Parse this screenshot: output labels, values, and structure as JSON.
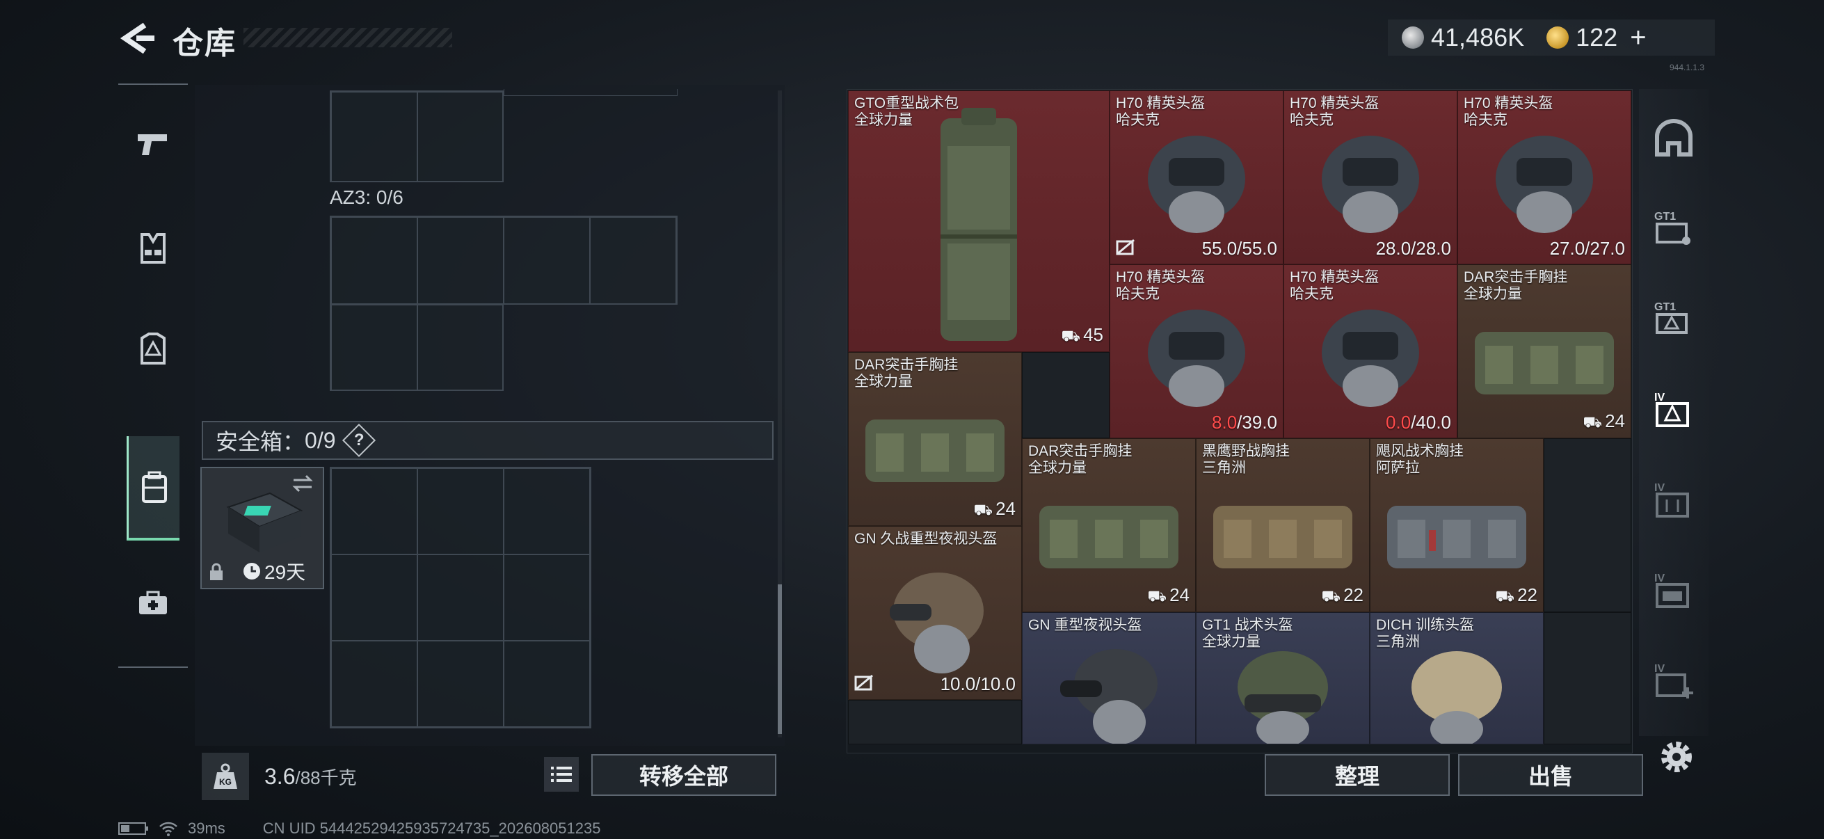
{
  "header": {
    "title": "仓库",
    "currencies": [
      {
        "icon": "silver-coin-icon",
        "value": "41,486K"
      },
      {
        "icon": "gold-coin-icon",
        "value": "122"
      }
    ],
    "add_label": "+",
    "version_tag": "944.1.1.3"
  },
  "left_nav": {
    "items": [
      {
        "name": "weapons",
        "icon": "pistol-icon"
      },
      {
        "name": "vests",
        "icon": "vest-icon"
      },
      {
        "name": "armor",
        "icon": "armor-plate-icon"
      },
      {
        "name": "backpack",
        "icon": "backpack-icon",
        "active": true
      },
      {
        "name": "medkit",
        "icon": "medkit-icon"
      }
    ]
  },
  "storage": {
    "az3_label": "AZ3: 0/6",
    "safe_box_label": "安全箱：",
    "safe_box_count": "0/9",
    "help_label": "?",
    "safe_item_time": "29天"
  },
  "bottom_left": {
    "weight_icon_label": "KG",
    "weight_value": "3.6",
    "weight_max": "/88千克",
    "transfer_all_label": "转移全部"
  },
  "bottom_right": {
    "organize_label": "整理",
    "sell_label": "出售"
  },
  "items": [
    {
      "name": "GTO重型战术包",
      "sub": "全球力量",
      "value": "45",
      "value_icon": "capacity-icon",
      "rarity": "red"
    },
    {
      "name": "H70 精英头盔",
      "sub": "哈夫克",
      "value": "55.0/55.0",
      "rarity": "red"
    },
    {
      "name": "H70 精英头盔",
      "sub": "哈夫克",
      "value": "28.0/28.0",
      "rarity": "red"
    },
    {
      "name": "H70 精英头盔",
      "sub": "哈夫克",
      "value": "27.0/27.0",
      "rarity": "red"
    },
    {
      "name": "H70 精英头盔",
      "sub": "哈夫克",
      "value_red": "8.0",
      "value_rest": "/39.0",
      "rarity": "red"
    },
    {
      "name": "H70 精英头盔",
      "sub": "哈夫克",
      "value_red": "0.0",
      "value_rest": "/40.0",
      "rarity": "red"
    },
    {
      "name": "DAR突击手胸挂",
      "sub": "全球力量",
      "value": "24",
      "rarity": "brown"
    },
    {
      "name": "DAR突击手胸挂",
      "sub": "全球力量",
      "value": "24",
      "rarity": "brown"
    },
    {
      "name": "DAR突击手胸挂",
      "sub": "全球力量",
      "value": "24",
      "rarity": "brown"
    },
    {
      "name": "黑鹰野战胸挂",
      "sub": "三角洲",
      "value": "22",
      "rarity": "brown"
    },
    {
      "name": "飓风战术胸挂",
      "sub": "阿萨拉",
      "value": "22",
      "rarity": "brown"
    },
    {
      "name": "GN 久战重型夜视头盔",
      "sub": "",
      "value": "10.0/10.0",
      "rarity": "brown"
    },
    {
      "name": "GN 重型夜视头盔",
      "sub": "",
      "value": "",
      "rarity": "blue"
    },
    {
      "name": "GT1 战术头盔",
      "sub": "全球力量",
      "value": "",
      "rarity": "blue"
    },
    {
      "name": "DICH 训练头盔",
      "sub": "三角洲",
      "value": "",
      "rarity": "blue"
    }
  ],
  "right_tabs": [
    {
      "label": "",
      "icon": "helmet-tab-icon"
    },
    {
      "label": "GT1",
      "icon": "gt1-tab-icon"
    },
    {
      "label": "GT1",
      "icon": "gt1-tab2-icon"
    },
    {
      "label": "IV",
      "icon": "tier4-tab-icon",
      "active": true
    },
    {
      "label": "IV",
      "icon": "tier4-tab2-icon"
    },
    {
      "label": "IV",
      "icon": "tier4-tab3-icon"
    },
    {
      "label": "IV",
      "icon": "tier4-add-tab-icon"
    }
  ],
  "status_bar": {
    "ping": "39ms",
    "uid": "CN UID 5444252942593572473​5_202608051235"
  },
  "colors": {
    "accent_green": "#79d9ae",
    "rarity_red": "#6b2a2e",
    "rarity_brown": "#4d3a2f",
    "rarity_blue": "#3a3f55",
    "durability_red": "#ff4b4b"
  }
}
